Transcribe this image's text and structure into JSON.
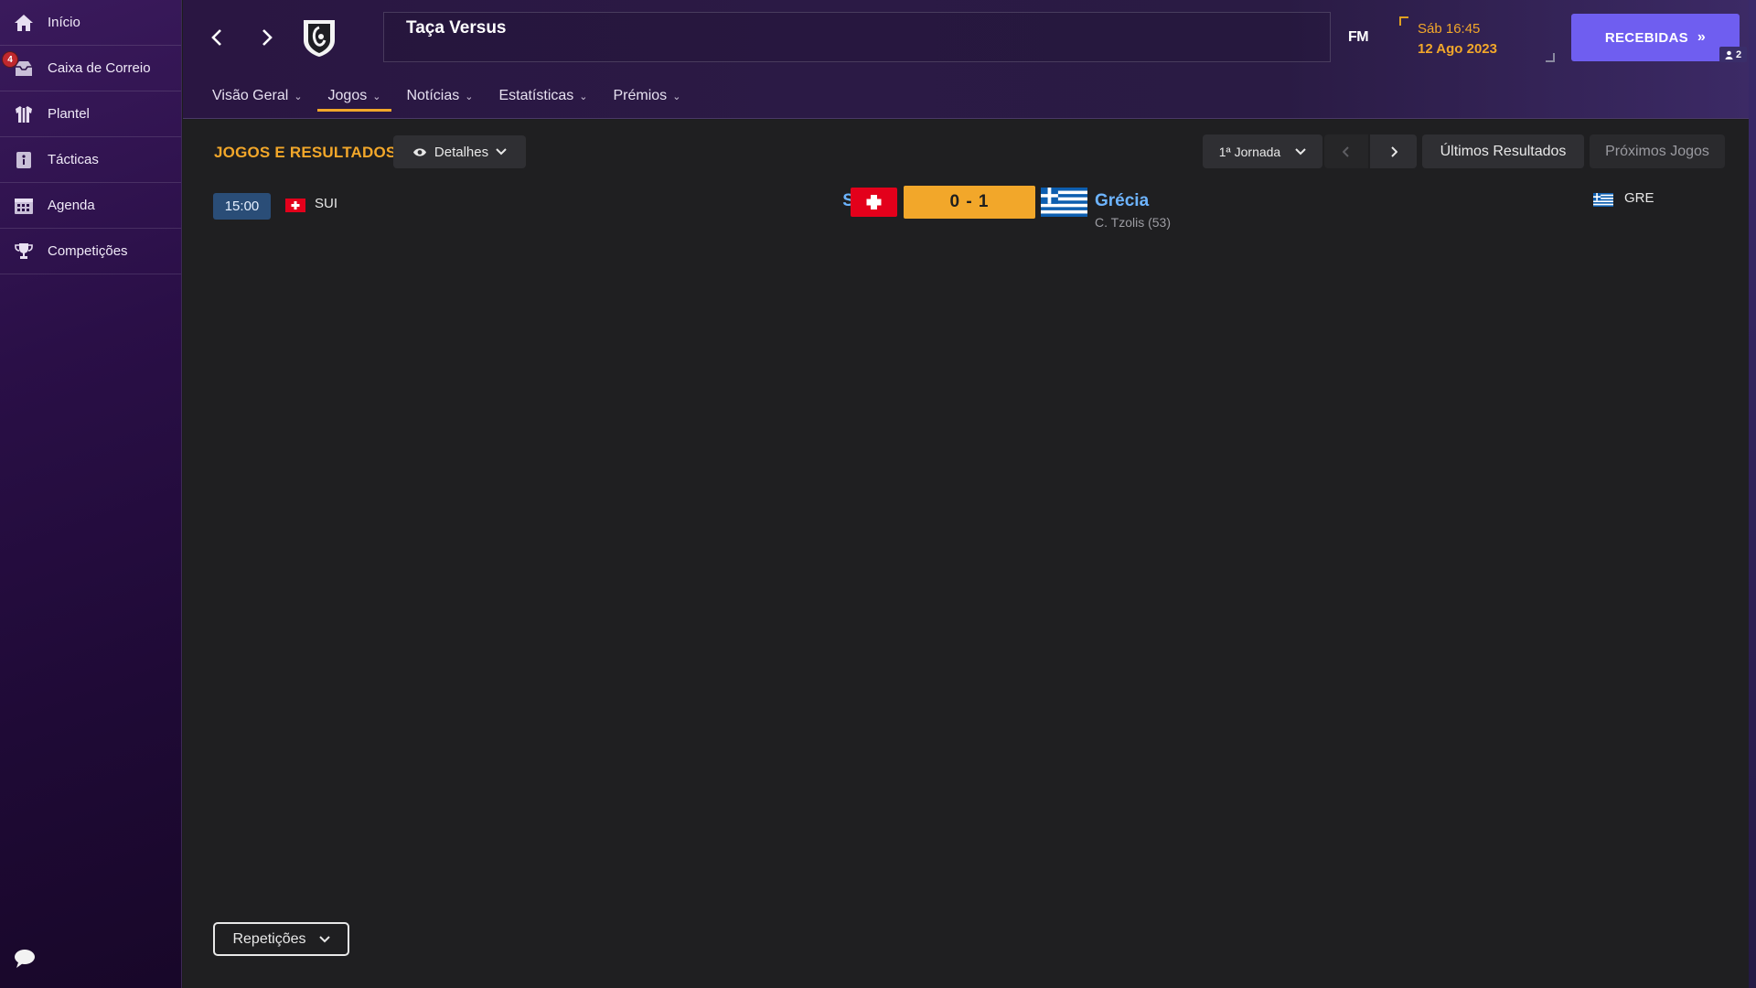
{
  "sidebar": {
    "items": [
      {
        "label": "Início",
        "icon": "home-icon"
      },
      {
        "label": "Caixa de Correio",
        "icon": "inbox-icon",
        "badge": "4"
      },
      {
        "label": "Plantel",
        "icon": "shirt-icon"
      },
      {
        "label": "Tácticas",
        "icon": "tactics-icon"
      },
      {
        "label": "Agenda",
        "icon": "calendar-icon"
      },
      {
        "label": "Competições",
        "icon": "trophy-icon"
      }
    ],
    "chat_icon": "chat-icon"
  },
  "header": {
    "title": "Taça Versus",
    "fm_logo": "FM",
    "time": "Sáb 16:45",
    "date": "12 Ago 2023",
    "continue_button": "RECEBIDAS",
    "user_count": "2",
    "tabs": [
      {
        "label": "Visão Geral",
        "active": false
      },
      {
        "label": "Jogos",
        "active": true
      },
      {
        "label": "Notícias",
        "active": false
      },
      {
        "label": "Estatísticas",
        "active": false
      },
      {
        "label": "Prémios",
        "active": false
      }
    ]
  },
  "content": {
    "section_title": "JOGOS E RESULTADOS",
    "details_button": "Detalhes",
    "round_select": "1ª Jornada",
    "latest_results": "Últimos Resultados",
    "next_matches": "Próximos Jogos",
    "replays_button": "Repetições",
    "match": {
      "time": "15:00",
      "home_code": "SUI",
      "home_name": "Suíça",
      "score": "0 - 1",
      "away_name": "Grécia",
      "away_code": "GRE",
      "scorer": "C. Tzolis (53)"
    }
  },
  "colors": {
    "accent_orange": "#f2a72a",
    "team_link_blue": "#6db4ff",
    "continue_purple": "#6f5ef0",
    "sidebar_purple": "#2a0f47",
    "badge_red": "#c0282e"
  }
}
